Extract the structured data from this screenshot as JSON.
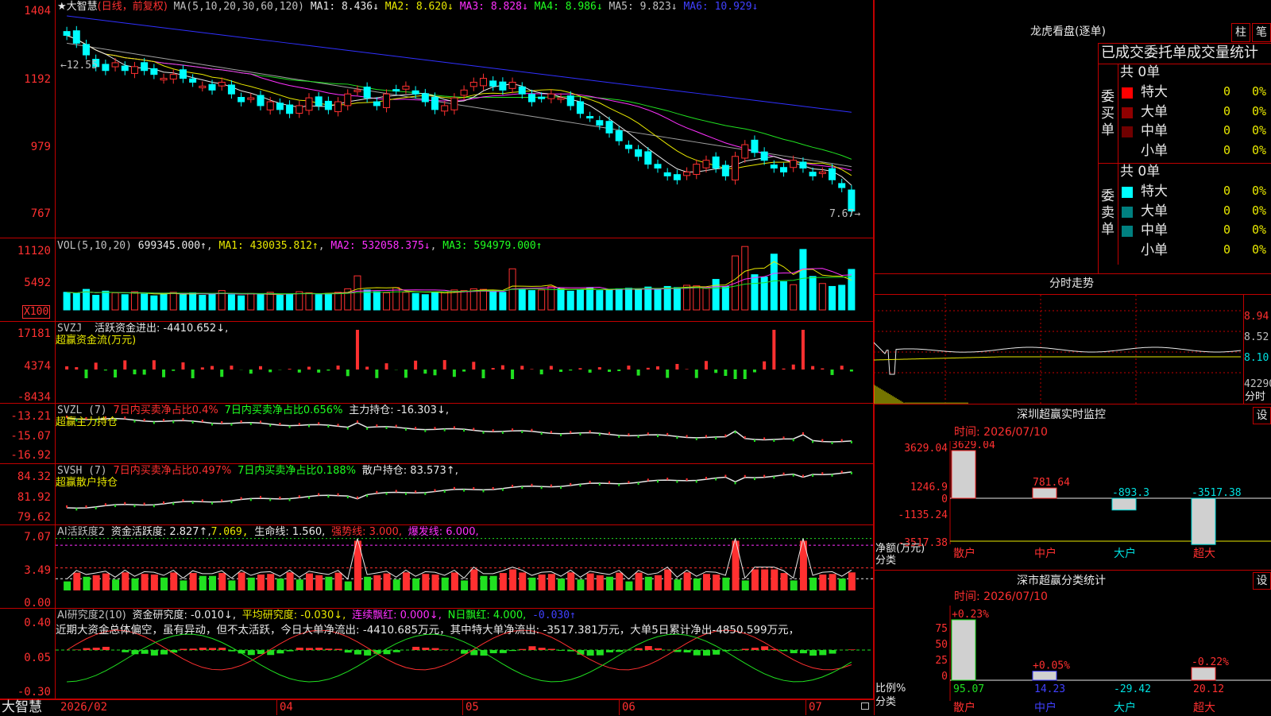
{
  "colors": {
    "up": "#ff3030",
    "down": "#00ffff",
    "grid": "#c00000",
    "bg": "#000000",
    "ma1": "#e8e8e8",
    "ma2": "#e8e800",
    "ma3": "#ff30ff",
    "ma4": "#20e020",
    "ma5": "#a0a0a0",
    "ma6": "#3030ff"
  },
  "main": {
    "title": "★大智慧",
    "period": "(日线，前复权)",
    "ma_label": "MA(5,10,20,30,60,120)",
    "ma1": "MA1: 8.436↓",
    "ma2": "MA2: 8.620↓",
    "ma3": "MA3: 8.828↓",
    "ma4": "MA4: 8.986↓",
    "ma5": "MA5: 9.823↓",
    "ma6": "MA6: 10.929↓",
    "y_ticks": [
      "1404",
      "1192",
      "979",
      "767"
    ],
    "high_label": "12.55",
    "low_label": "7.67"
  },
  "vol": {
    "label": "VOL(5,10,20)",
    "value": "699345.000↑",
    "ma1": "MA1: 430035.812↑",
    "ma2": "MA2: 532058.375↓",
    "ma3": "MA3: 594979.000↑",
    "y_ticks": [
      "11120",
      "5492"
    ],
    "unit": "X100"
  },
  "svzj": {
    "label": "SVZJ",
    "text1": "活跃资金进出: -4410.652↓,",
    "text2": "超赢资金流(万元)",
    "y_ticks": [
      "17181",
      "4374",
      "-8434"
    ]
  },
  "svzl": {
    "label": "SVZL (7)",
    "t1": "7日内买卖净占比0.4%",
    "t2": "7日内买卖净占比0.656%",
    "t3": "主力持仓: -16.303↓,",
    "sub": "超赢主力持仓",
    "y_ticks": [
      "-13.21",
      "-15.07",
      "-16.92"
    ]
  },
  "svsh": {
    "label": "SVSH (7)",
    "t1": "7日内买卖净占比0.497%",
    "t2": "7日内买卖净占比0.188%",
    "t3": "散户持仓: 83.573↑,",
    "sub": "超赢散户持仓",
    "y_ticks": [
      "84.32",
      "81.92",
      "79.62"
    ]
  },
  "ai1": {
    "label": "AI活跃度2",
    "t1": "资金活跃度: 2.827↑,",
    "t2": "7.069,",
    "t3": "生命线: 1.560,",
    "t4": "强势线: 3.000,",
    "t5": "爆发线: 6.000,",
    "y_ticks": [
      "7.07",
      "3.49",
      "0.00"
    ]
  },
  "ai2": {
    "label": "AI研究度2(10)",
    "t1": "资金研究度: -0.010↓,",
    "t2": "平均研究度: -0.030↓,",
    "t3": "连续飘红: 0.000↓,",
    "t4": "N日飘红: 4.000,",
    "t5": "-0.030↑",
    "desc": "近期大资金总体偏空，虽有异动，但不太活跃，今日大单净流出: -4410.685万元，其中特大单净流出: -3517.381万元，大单5日累计净出-4850.599万元，",
    "y_ticks": [
      "0.40",
      "0.05",
      "-0.30"
    ]
  },
  "bottom": {
    "brand": "大智慧",
    "dates": [
      "2026/02",
      "04",
      "05",
      "06",
      "07"
    ]
  },
  "right": {
    "dragon_title": "龙虎看盘(逐单)",
    "btn_zhu": "柱",
    "btn_bi": "笔",
    "stat_title": "已成交委托单成交量统计",
    "buy_group": "委买单",
    "sell_group": "委卖单",
    "buy_total": "共 0单",
    "sell_total": "共 0单",
    "buy_rows": [
      {
        "name": "特大",
        "vol": "0",
        "pct": "0%",
        "color": "#ff0000"
      },
      {
        "name": "大单",
        "vol": "0",
        "pct": "0%",
        "color": "#900000"
      },
      {
        "name": "中单",
        "vol": "0",
        "pct": "0%",
        "color": "#700000"
      },
      {
        "name": "小单",
        "vol": "0",
        "pct": "0%",
        "color": ""
      }
    ],
    "sell_rows": [
      {
        "name": "特大",
        "vol": "0",
        "pct": "0%",
        "color": "#00ffff"
      },
      {
        "name": "大单",
        "vol": "0",
        "pct": "0%",
        "color": "#008080"
      },
      {
        "name": "中单",
        "vol": "0",
        "pct": "0%",
        "color": "#008080"
      },
      {
        "name": "小单",
        "vol": "0",
        "pct": "0%",
        "color": ""
      }
    ],
    "fenshi_title": "分时走势",
    "fenshi_prices": [
      "8.94",
      "8.52",
      "8.10"
    ],
    "fenshi_vol": "42290",
    "fenshi_unit": "分时",
    "sz_title": "深圳超赢实时监控",
    "sz_btn": "设",
    "sz_time": "时间: 2026/07/10",
    "sz_y": [
      "3629.04",
      "1246.9",
      "0",
      "-1135.24",
      "-3517.38"
    ],
    "sz_unit1": "净额(万元)",
    "sz_unit2": "分类",
    "sz_values": [
      {
        "cat": "散户",
        "val": "3629.04",
        "num": 3629.04
      },
      {
        "cat": "中户",
        "val": "781.64",
        "num": 781.64
      },
      {
        "cat": "大户",
        "val": "-893.3",
        "num": -893.3
      },
      {
        "cat": "超大",
        "val": "-3517.38",
        "num": -3517.38
      }
    ],
    "ss_title": "深市超赢分类统计",
    "ss_btn": "设",
    "ss_time": "时间: 2026/07/10",
    "ss_y": [
      "75",
      "50",
      "25",
      "0"
    ],
    "ss_unit1": "比例%",
    "ss_unit2": "分类",
    "ss_values": [
      {
        "cat": "散户",
        "top": "+0.23%",
        "bot": "95.07",
        "pct": 95.07
      },
      {
        "cat": "中户",
        "top": "+0.05%",
        "bot": "14.23",
        "pct": 14.23
      },
      {
        "cat": "大户",
        "top": "",
        "bot": "-29.42",
        "pct": 0
      },
      {
        "cat": "超大",
        "top": "-0.22%",
        "bot": "20.12",
        "pct": 20.12
      }
    ]
  },
  "chart_data": {
    "type": "candlestick",
    "title": "★大智慧",
    "y_range": [
      7.67,
      12.55
    ],
    "notes": "daily candles, values approximate; close values (data units)",
    "closes": [
      12.4,
      12.2,
      11.9,
      11.6,
      11.5,
      11.7,
      11.5,
      11.6,
      11.5,
      11.4,
      11.3,
      11.4,
      11.3,
      11.2,
      11.1,
      11.0,
      11.2,
      10.9,
      10.7,
      10.8,
      10.6,
      10.7,
      10.5,
      10.4,
      10.6,
      10.8,
      10.6,
      10.5,
      10.7,
      10.9,
      11.0,
      10.8,
      10.6,
      10.9,
      11.0,
      11.1,
      10.9,
      10.7,
      10.5,
      10.6,
      10.8,
      11.0,
      11.2,
      11.3,
      11.1,
      11.0,
      11.2,
      10.9,
      10.7,
      10.8,
      10.9,
      10.8,
      10.6,
      10.4,
      10.3,
      10.1,
      9.9,
      9.7,
      9.5,
      9.3,
      9.1,
      9.0,
      8.8,
      8.7,
      8.9,
      9.1,
      9.2,
      9.0,
      8.8,
      9.3,
      9.6,
      9.4,
      9.2,
      9.0,
      8.9,
      9.2,
      9.0,
      8.8,
      8.9,
      8.7,
      8.5,
      7.9
    ],
    "volumes": [
      3000,
      2800,
      3500,
      2500,
      3200,
      2900,
      2600,
      3100,
      2700,
      2400,
      2800,
      3000,
      2600,
      2900,
      2500,
      2700,
      3300,
      2600,
      2400,
      2800,
      2600,
      3000,
      2500,
      2700,
      3100,
      2900,
      2600,
      2800,
      3000,
      3600,
      5800,
      3400,
      3100,
      2900,
      3800,
      3000,
      2800,
      2600,
      3000,
      3100,
      3400,
      3300,
      3600,
      3500,
      3200,
      3000,
      7000,
      3500,
      3300,
      3400,
      4000,
      3600,
      3200,
      3500,
      3800,
      3300,
      3400,
      3600,
      3700,
      3500,
      3900,
      3500,
      4000,
      3800,
      4200,
      4100,
      3700,
      5200,
      4000,
      9200,
      10800,
      6000,
      5600,
      9500,
      4800,
      4300,
      10300,
      5700,
      4500,
      4000,
      4200,
      6900
    ]
  }
}
